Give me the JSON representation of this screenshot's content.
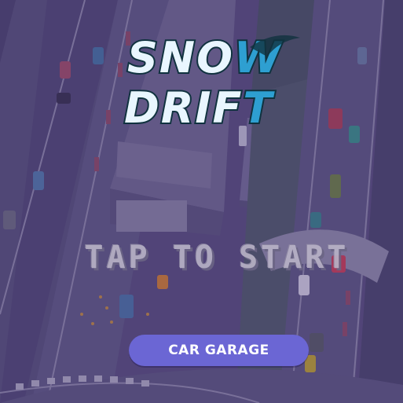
{
  "logo": {
    "line1_prefix": "SNO",
    "line1_suffix": "W",
    "line2_prefix": "DRIF",
    "line2_suffix": "T"
  },
  "prompt": {
    "tap_to_start": "TAP TO START"
  },
  "buttons": {
    "car_garage": "CAR GARAGE"
  },
  "colors": {
    "overlay": "#3b2a73",
    "button": "#6b66d4",
    "logo_fill": "#e9f6ff",
    "logo_outline": "#10323f",
    "logo_accent": "#2e9fd1"
  }
}
